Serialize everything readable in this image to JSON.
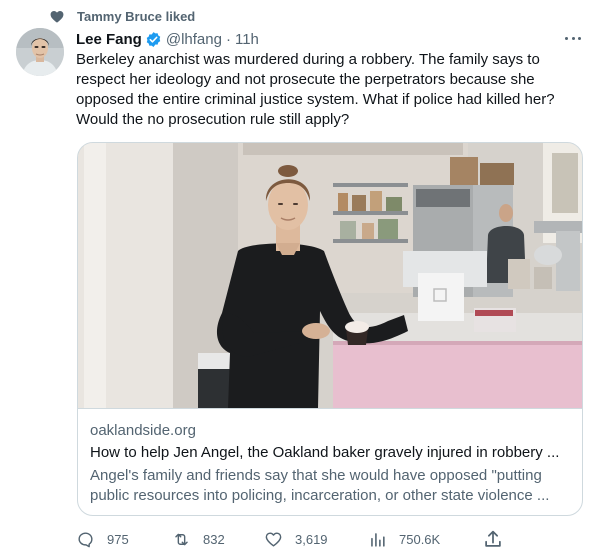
{
  "social_context": {
    "text": "Tammy Bruce liked"
  },
  "tweet": {
    "author_name": "Lee Fang",
    "handle": "@lhfang",
    "separator": "·",
    "time": "11h",
    "text": "Berkeley anarchist was murdered during a robbery. The family says to respect her ideology and not prosecute the perpetrators because she opposed the entire criminal justice system. What if police had killed her? Would the no prosecution rule still apply?"
  },
  "card": {
    "domain": "oaklandside.org",
    "title": "How to help Jen Angel, the Oakland baker gravely injured in robbery ...",
    "description": "Angel's family and friends say that she would have opposed \"putting public resources into policing, incarceration, or other state violence ..."
  },
  "actions": {
    "replies": "975",
    "retweets": "832",
    "likes": "3,619",
    "views": "750.6K"
  },
  "colors": {
    "text": "#0f1419",
    "secondary": "#536471",
    "verified": "#1d9bf0",
    "border": "#cfd9de"
  },
  "icons": [
    "heart-icon",
    "verified-badge-icon",
    "more-icon",
    "reply-icon",
    "retweet-icon",
    "like-icon",
    "views-icon",
    "share-icon"
  ]
}
